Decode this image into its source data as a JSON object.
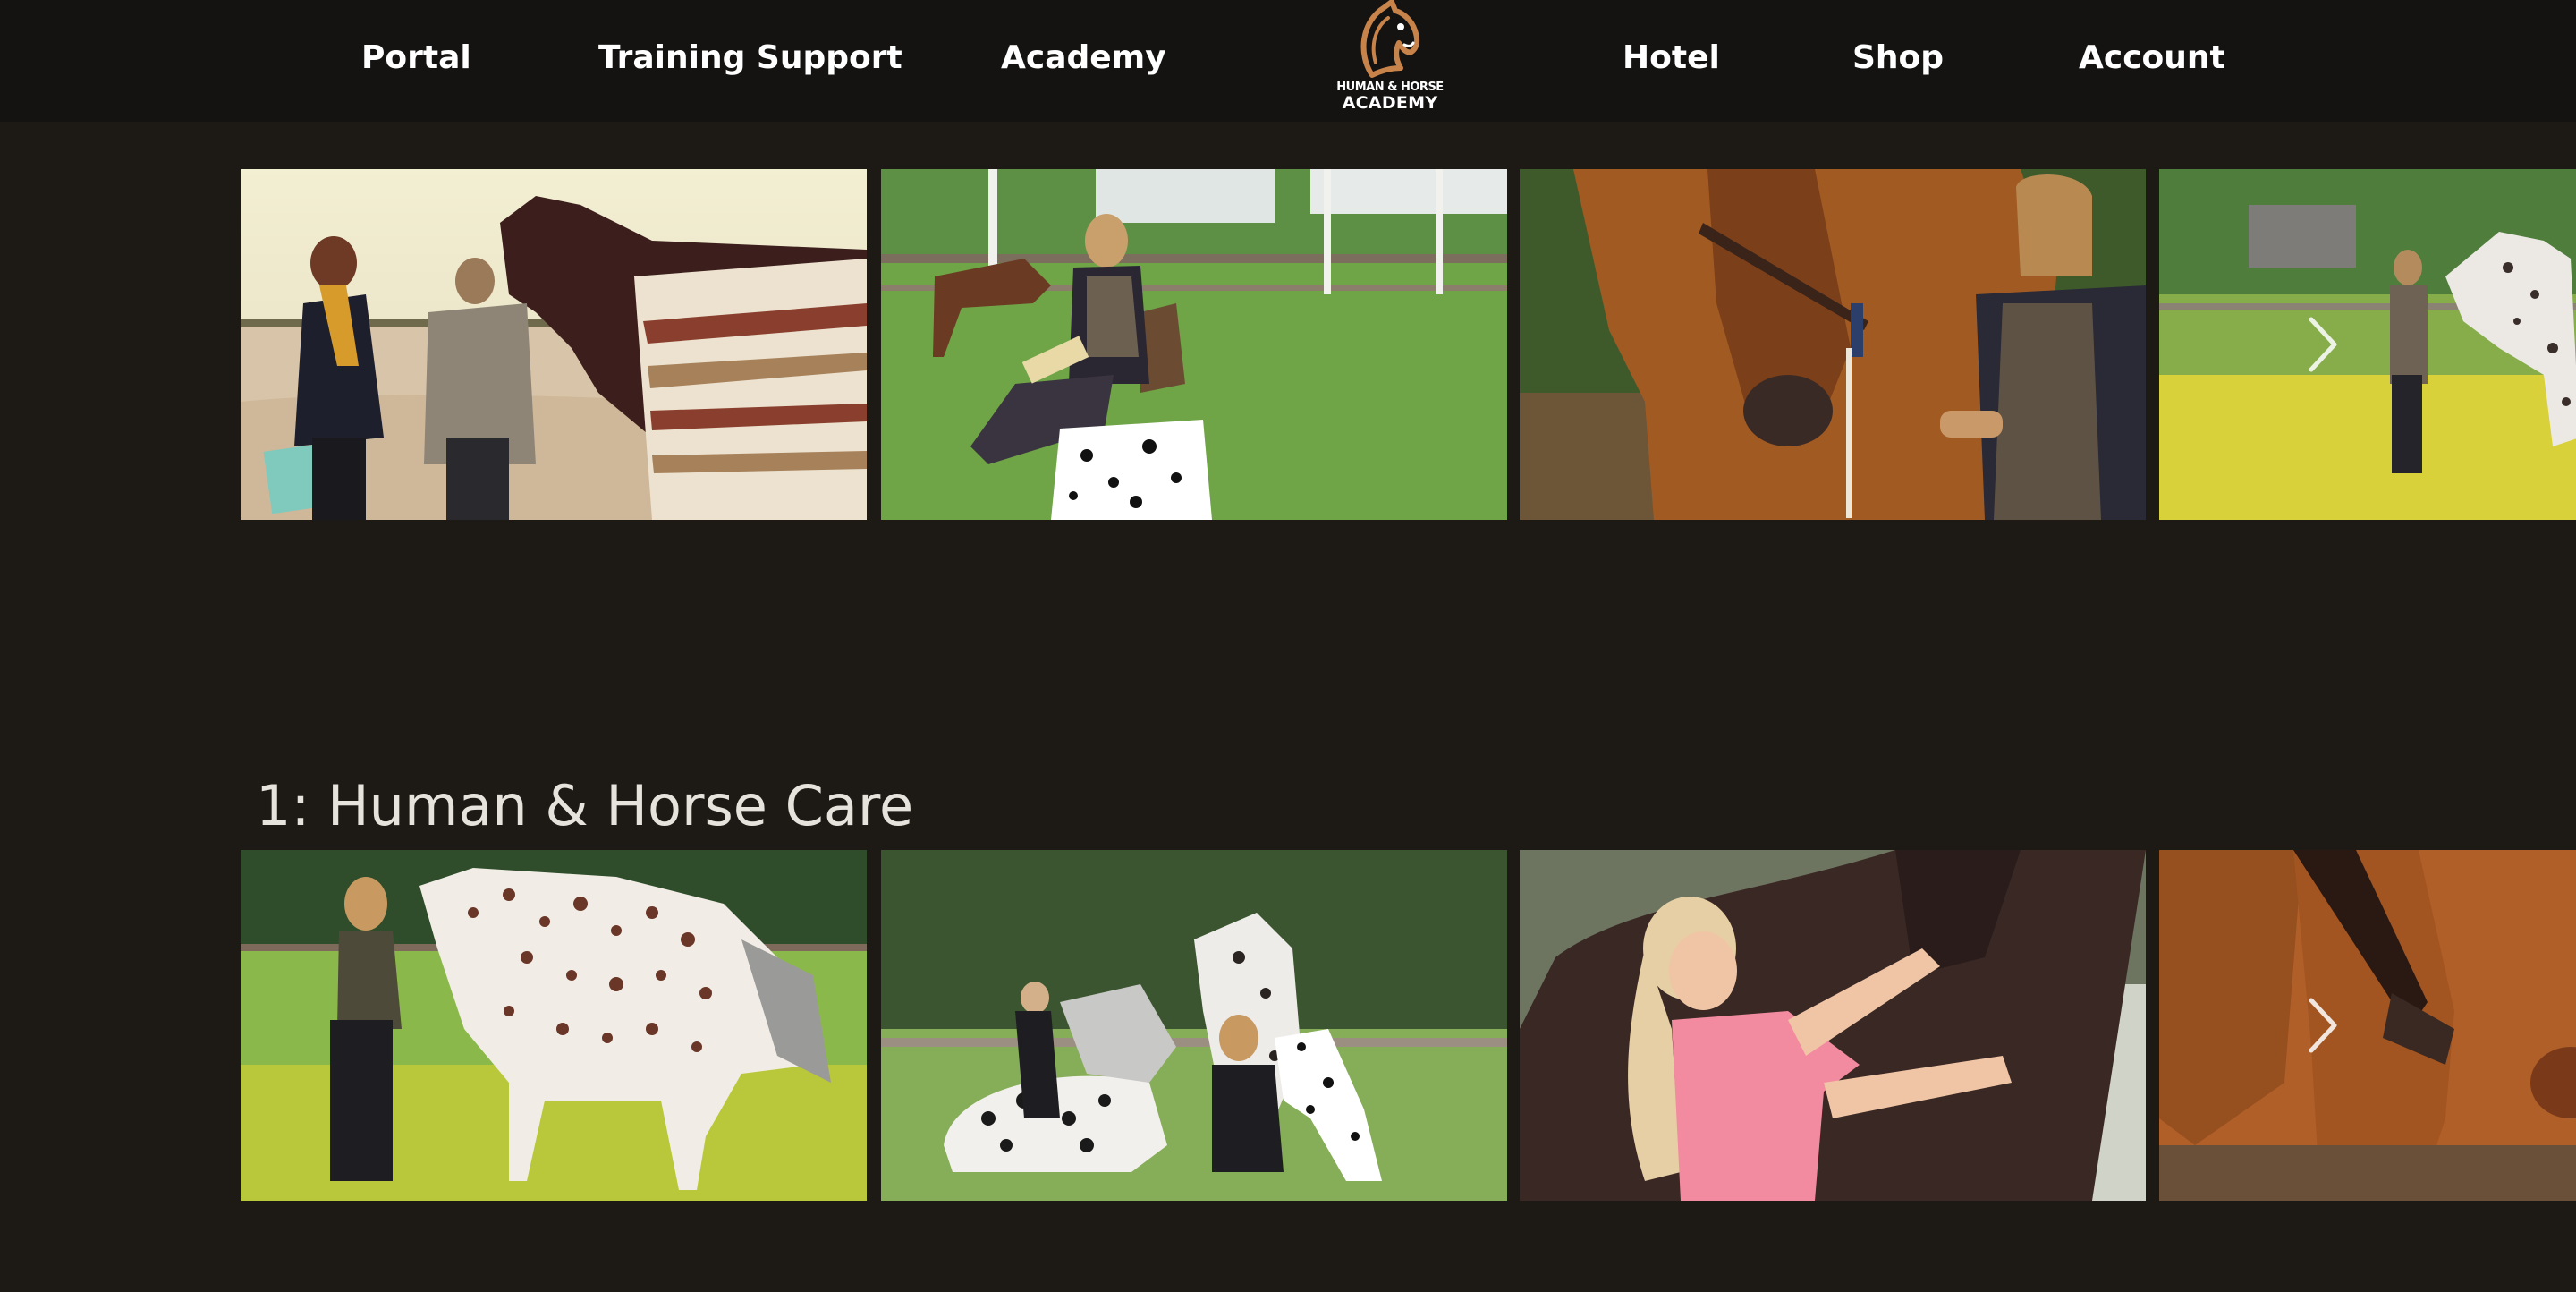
{
  "nav": {
    "portal": "Portal",
    "training_support": "Training Support",
    "academy": "Academy",
    "hotel": "Hotel",
    "shop": "Shop",
    "account": "Account"
  },
  "logo": {
    "line1": "HUMAN & HORSE",
    "line2": "ACADEMY",
    "icon": "horse-head-icon"
  },
  "carousels": [
    {
      "title": "",
      "cards": [
        {
          "thumbnail": "two-women-with-blanketed-horse-on-sand"
        },
        {
          "thumbnail": "woman-seated-with-book-and-dalmatian"
        },
        {
          "thumbnail": "woman-beside-chestnut-horse-closeup"
        },
        {
          "thumbnail": "woman-leading-spotted-horse-in-field"
        }
      ],
      "next_icon": "chevron-right-icon"
    },
    {
      "title": "1: Human & Horse Care",
      "cards": [
        {
          "thumbnail": "woman-with-appaloosa-horse-in-meadow"
        },
        {
          "thumbnail": "pony-bowing-with-girl-woman-and-dalmatian"
        },
        {
          "thumbnail": "girl-in-pink-petting-dark-horse"
        },
        {
          "thumbnail": "chestnut-horse-in-bridle-closeup"
        }
      ],
      "next_icon": "chevron-right-icon"
    }
  ],
  "colors": {
    "page_background": "#1d1a16",
    "header_background": "#141311",
    "logo_accent": "#c8834a",
    "title_text": "#e6e3dc"
  }
}
